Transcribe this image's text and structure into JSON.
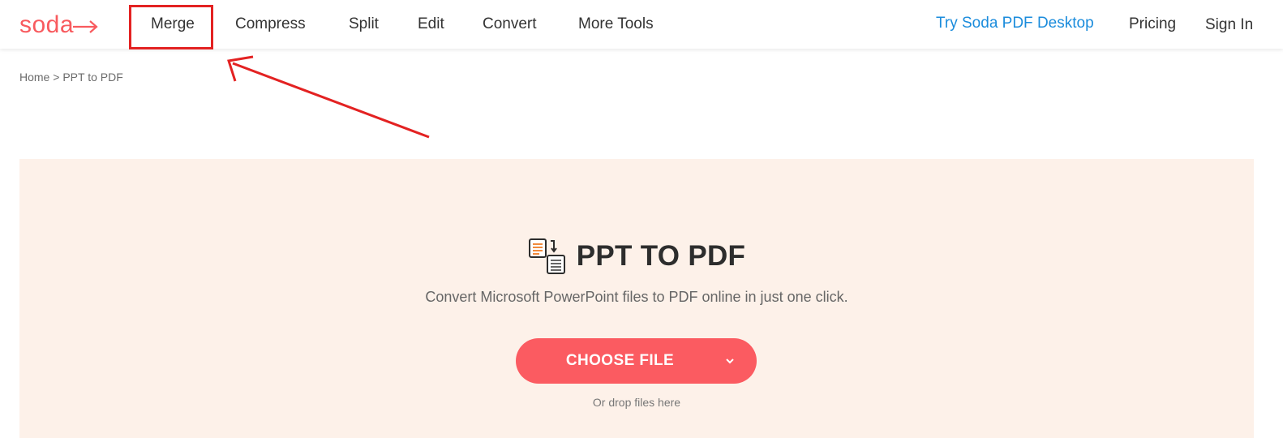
{
  "header": {
    "logo_text": "soda",
    "nav": {
      "merge": "Merge",
      "compress": "Compress",
      "split": "Split",
      "edit": "Edit",
      "convert": "Convert",
      "more_tools": "More Tools"
    },
    "try_desktop": "Try Soda PDF Desktop",
    "pricing": "Pricing",
    "sign_in": "Sign In"
  },
  "breadcrumb": {
    "home": "Home",
    "separator": ">",
    "current": "PPT to PDF"
  },
  "hero": {
    "title": "PPT TO PDF",
    "subtitle": "Convert Microsoft PowerPoint files to PDF online in just one click.",
    "choose_file": "CHOOSE FILE",
    "drop_hint": "Or drop files here"
  },
  "colors": {
    "brand": "#f85a5e",
    "button": "#fb5b61",
    "hero_bg": "#fdf1e9",
    "link_blue": "#1b8cdc",
    "annotation": "#e32222"
  },
  "icons": {
    "logo_arrow": "arrow-right-icon",
    "title_icon": "convert-document-icon",
    "dropdown": "chevron-down-icon"
  }
}
